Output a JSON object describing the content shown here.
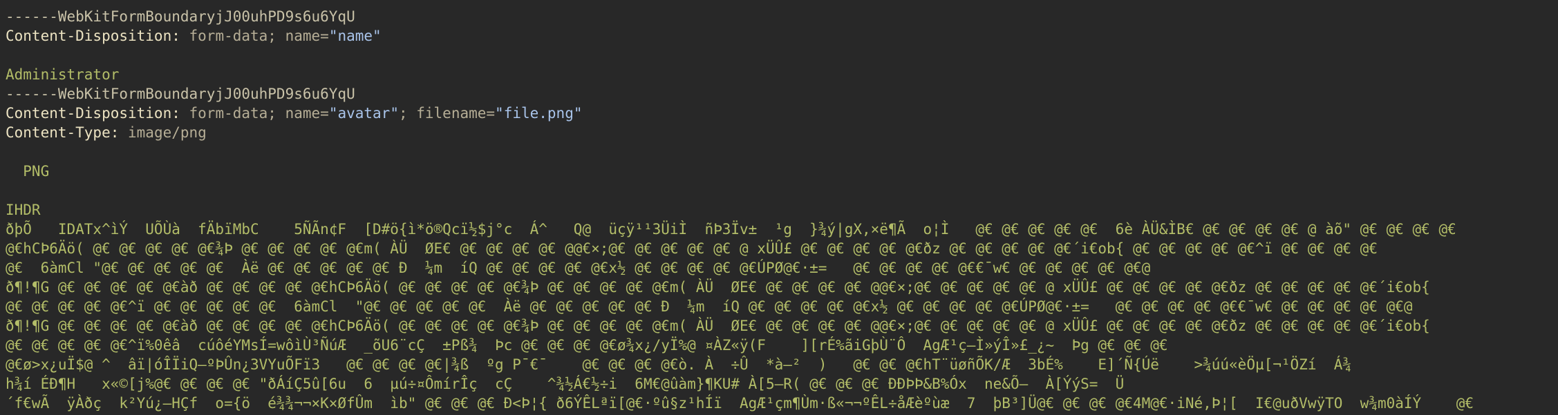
{
  "request_body": {
    "part1": {
      "boundary": "------WebKitFormBoundaryjJ00uhPD9s6u6YqU",
      "disposition_key": "Content-Disposition:",
      "disposition_value": " form-data; name=",
      "name_value": "\"name\"",
      "body_value": "Administrator"
    },
    "part2": {
      "boundary": "------WebKitFormBoundaryjJ00uhPD9s6u6YqU",
      "disposition_key": "Content-Disposition:",
      "disposition_value": " form-data; name=",
      "name_value": "\"avatar\"",
      "filename_sep": "; filename=",
      "filename_value": "\"file.png\"",
      "type_key": "Content-Type:",
      "type_value": " image/png"
    },
    "binary": {
      "png_marker": "  PNG",
      "ihdr_marker": "IHDR",
      "lines": [
        "ðþÕ   IDATx^ìÝ  UÕÙà  fÄbïMbC    5ÑÃn¢F  [D#ö{ì*ö®Qcï½$j°c  Á^   Q@  üçÿ¹¹3ÜiÌ  ñÞ3Ïv±  ¹g  }¾ý|gX,×ë¶Ã  o¦Ì   @€ @€ @€ @€ @€  6è ÀÜ&ÌB€ @€ @€ @€ @€ @ àõ\" @€ @€ @€ @€",
        "@€hCÞ6Äö( @€ @€ @€ @€ @€¾Þ @€ @€ @€ @€ @€m( ÀÜ  ØE€ @€ @€ @€ @€ @@€×;@€ @€ @€ @€ @€ @ xÜÛ£ @€ @€ @€ @€ @€ðz @€ @€ @€ @€ @€´i€ob{ @€ @€ @€ @€ @€^ï @€ @€ @€ @€",
        "@€  6àmCl \"@€ @€ @€ @€ @€  Àë @€ @€ @€ @€ @€ Ð  ¼m  íQ @€ @€ @€ @€ @€x½ @€ @€ @€ @€ @€ÚPØ@€·±=   @€ @€ @€ @€ @€€¯w€ @€ @€ @€ @€ @€@",
        "ð¶!¶G @€ @€ @€ @€ @€àð @€ @€ @€ @€ @€hCÞ6Äö( @€ @€ @€ @€ @€¾Þ @€ @€ @€ @€ @€m( ÀÜ  ØE€ @€ @€ @€ @€ @@€×;@€ @€ @€ @€ @€ @ xÜÛ£ @€ @€ @€ @€ @€ðz @€ @€ @€ @€ @€´i€ob{",
        "@€ @€ @€ @€ @€^ï @€ @€ @€ @€ @€  6àmCl  \"@€ @€ @€ @€ @€  Àë @€ @€ @€ @€ @€ Ð  ¼m  íQ @€ @€ @€ @€ @€x½ @€ @€ @€ @€ @€ÚPØ@€·±=   @€ @€ @€ @€ @€€¯w€ @€ @€ @€ @€ @€@",
        "ð¶!¶G @€ @€ @€ @€ @€àð @€ @€ @€ @€ @€hCÞ6Äö( @€ @€ @€ @€ @€¾Þ @€ @€ @€ @€ @€m( ÀÜ  ØE€ @€ @€ @€ @€ @@€×;@€ @€ @€ @€ @€ @ xÜÛ£ @€ @€ @€ @€ @€ðz @€ @€ @€ @€ @€´i€ob{",
        "@€ @€ @€ @€ @€^ï%0êâ  cúôéYMsÍ=wôìÙ³ÑúÆ  _õU6¨cÇ  ±Pß¾  Þc @€ @€ @€ @€ø¾x¿/yÏ%@ ¤ÀZ«ÿ(F    ][rÉ%ãiGþÙ¨Ô  AgÆ¹ç–Ì»ýÎ»£_¿~  Þg @€ @€ @€",
        "@€ø>x¿uÏ$@ ^  âï|óÎÏiQ–ºÞÛn¿3VYuÕFï3   @€ @€ @€ @€|¾ß  ºg P¯€¯    @€ @€ @€ @€ò. À  ÷Û  *à–²  )   @€ @€ @€hT¨üøñÕK/Æ  3bÉ%    E]´Ñ{Úë    >¾úú«èÖµ[¬¹ÖZí  Á¾",
        "h¾í ÉÐ¶H   x«©[j%@€ @€ @€ @€ \"ðÁíÇ5û[6u  6  µú÷¤ÔmírÎç  cÇ    ^¾½Á€½÷i  6M€@ûàm}¶KU# À[5–R( @€ @€ @€ ÐÐÞÞ&B%Óx  ne&Õ–  À[ÝýS=  Ü",
        "´f€wÃ  ÿÀðç  k²Yú¿–HÇf  o={ö  é¾¾¬¬×K×ØfÛm  ìb\" @€ @€ @€ Ð<Þ¦{ ð6ÝÊLªï[@€·ºû§z¹hÍï  AgÆ¹çm¶Ùm·ß«¬¬ºÊL÷åÆèºùæ  7  þB³]Ü@€ @€ @€ @€4M@€·iNé,Þ¦[  I€@uðVwÿTO  w¾m0àÍÝ    @€"
      ]
    }
  }
}
